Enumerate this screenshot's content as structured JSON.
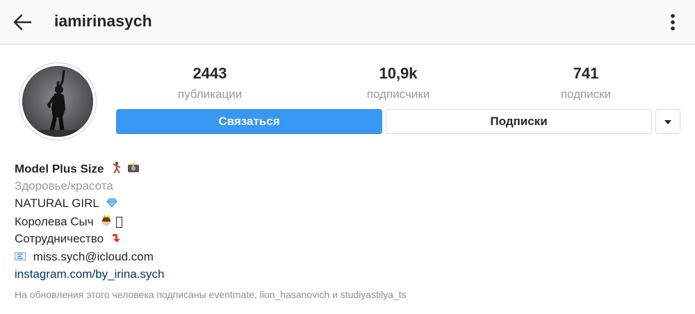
{
  "header": {
    "username": "iamirinasych",
    "back_icon": "arrow-left-icon",
    "menu_icon": "more-vertical-icon"
  },
  "profile": {
    "avatar_icon": "profile-photo"
  },
  "stats": [
    {
      "value": "2443",
      "label": "публикации"
    },
    {
      "value": "10,9k",
      "label": "подписчики"
    },
    {
      "value": "741",
      "label": "подписки"
    }
  ],
  "actions": {
    "contact_label": "Связаться",
    "following_label": "Подписки",
    "dropdown_icon": "caret-down-icon"
  },
  "bio": {
    "name": "Model Plus Size",
    "category": "Здоровье/красота",
    "lines": [
      "NATURAL GIRL",
      "Королева Сыч",
      "Сотрудничество"
    ],
    "email": "miss.sych@icloud.com",
    "link": "instagram.com/by_irina.sych",
    "followed_by": "На обновления этого человека подписаны eventmate, lion_hasanovich и studiyastilya_ts"
  },
  "colors": {
    "accent": "#3897f0",
    "link": "#003569",
    "muted": "#8e8e8e"
  }
}
